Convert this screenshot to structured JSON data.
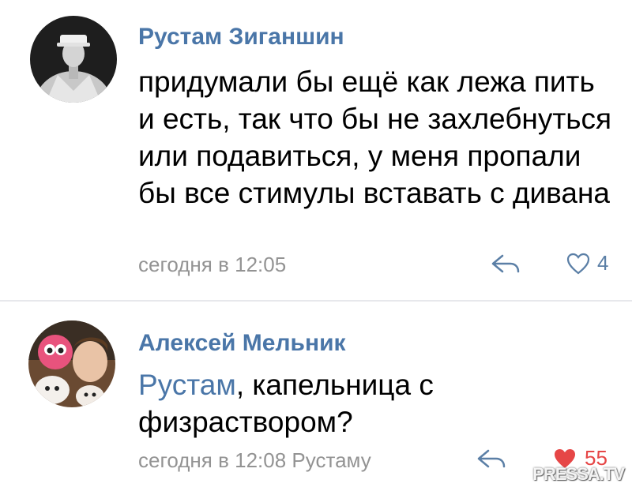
{
  "comments": [
    {
      "author": "Рустам Зиганшин",
      "text": "придумали бы ещё как лежа пить и есть, так что бы не захлебнуться или подавиться, у меня пропали бы все стимулы вставать с дивана",
      "time": "сегодня в 12:05",
      "likes": "4",
      "liked": false,
      "avatar_icon": "user-photo-grayscale"
    },
    {
      "author": "Алексей Мельник",
      "mention": "Рустам",
      "text": ", капельница с физраствором?",
      "time": "сегодня в 12:08 Рустаму",
      "likes": "55",
      "liked": true,
      "avatar_icon": "user-photo-with-plush-toys"
    }
  ],
  "colors": {
    "link": "#4a76a8",
    "meta": "#939393",
    "like_active": "#e64646",
    "divider": "#e7e8ec"
  },
  "watermark": "PRESSA.TV"
}
